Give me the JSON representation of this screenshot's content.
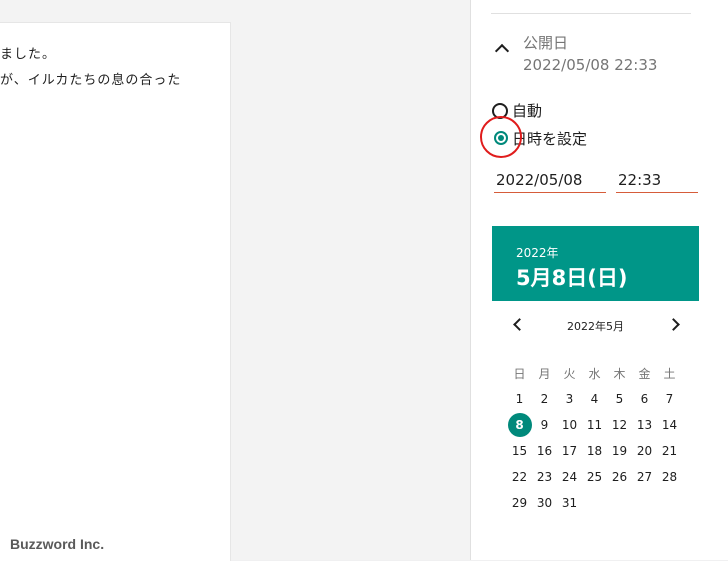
{
  "editor": {
    "lines": [
      "ました。",
      "が、イルカたちの息の合った"
    ],
    "watermark": "Buzzword Inc."
  },
  "sidebar": {
    "publish_label": "公開日",
    "publish_value": "2022/05/08 22:33",
    "radio_auto": "自動",
    "radio_set": "日時を設定",
    "date_field": "2022/05/08",
    "time_field": "22:33"
  },
  "calendar": {
    "year": "2022年",
    "date_heading": "5月8日(日)",
    "month_title": "2022年5月",
    "weekdays": [
      "日",
      "月",
      "火",
      "水",
      "木",
      "金",
      "土"
    ],
    "weeks": [
      [
        "1",
        "2",
        "3",
        "4",
        "5",
        "6",
        "7"
      ],
      [
        "8",
        "9",
        "10",
        "11",
        "12",
        "13",
        "14"
      ],
      [
        "15",
        "16",
        "17",
        "18",
        "19",
        "20",
        "21"
      ],
      [
        "22",
        "23",
        "24",
        "25",
        "26",
        "27",
        "28"
      ],
      [
        "29",
        "30",
        "31",
        "",
        "",
        "",
        ""
      ]
    ],
    "selected": "8"
  },
  "colors": {
    "accent": "#009688",
    "highlight_circle": "#e01c1c",
    "field_underline": "#d65c3a"
  }
}
